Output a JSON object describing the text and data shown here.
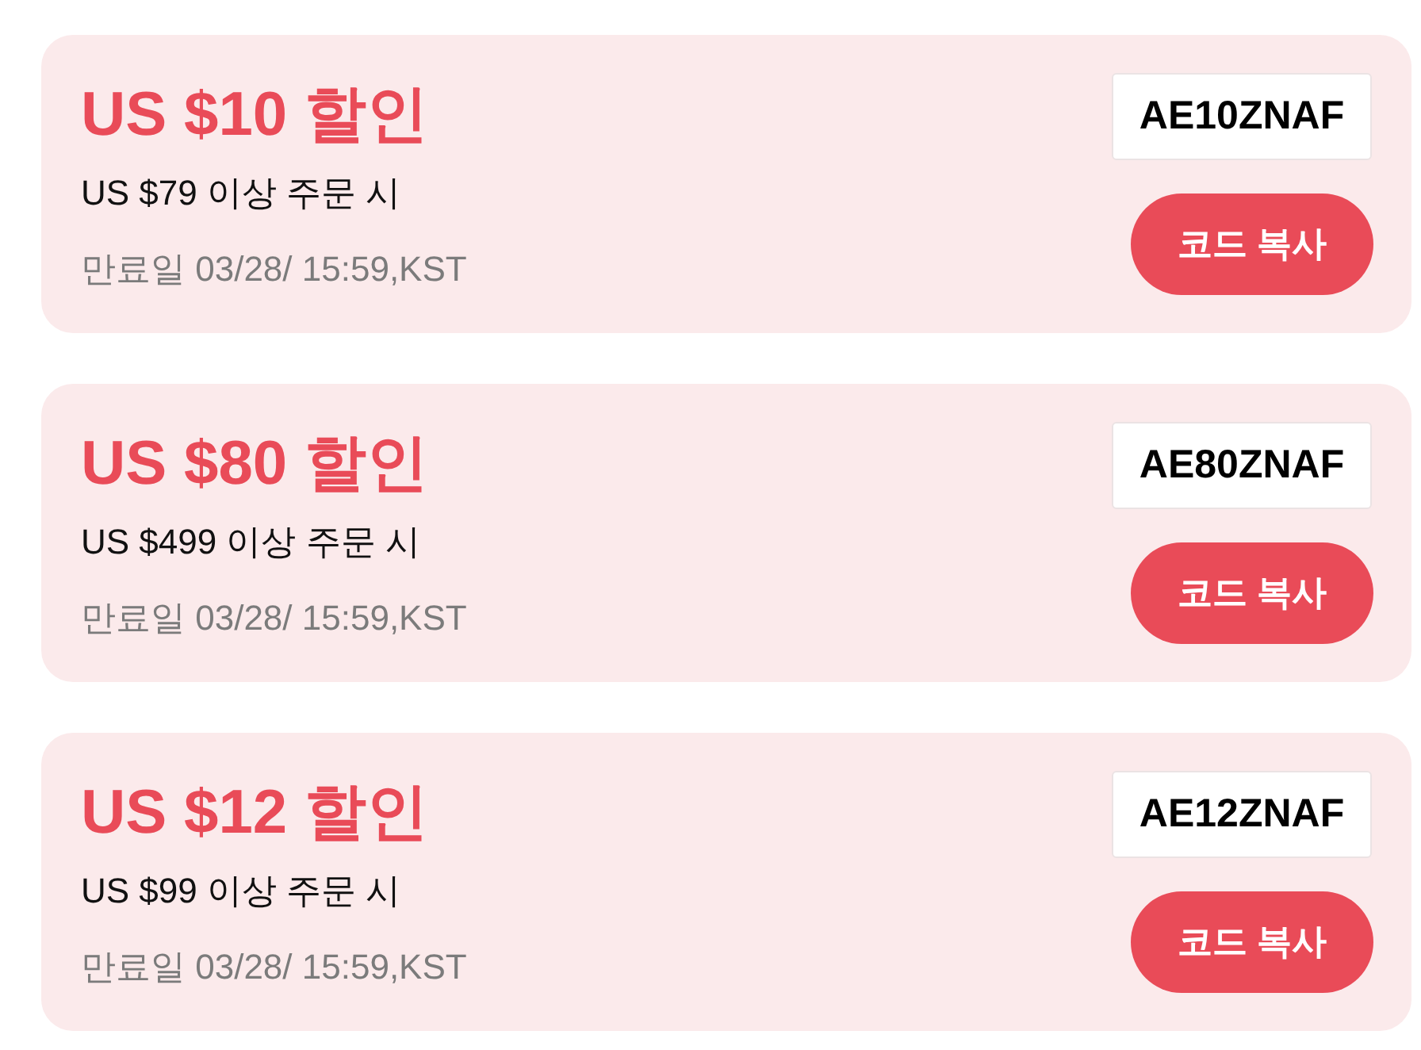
{
  "coupons": [
    {
      "title": "US $10 할인",
      "condition": "US $79 이상 주문 시",
      "expiry": "만료일 03/28/ 15:59,KST",
      "code": "AE10ZNAF",
      "button": "코드 복사"
    },
    {
      "title": "US $80 할인",
      "condition": "US $499 이상 주문 시",
      "expiry": "만료일 03/28/ 15:59,KST",
      "code": "AE80ZNAF",
      "button": "코드 복사"
    },
    {
      "title": "US $12 할인",
      "condition": "US $99 이상 주문 시",
      "expiry": "만료일 03/28/ 15:59,KST",
      "code": "AE12ZNAF",
      "button": "코드 복사"
    }
  ]
}
